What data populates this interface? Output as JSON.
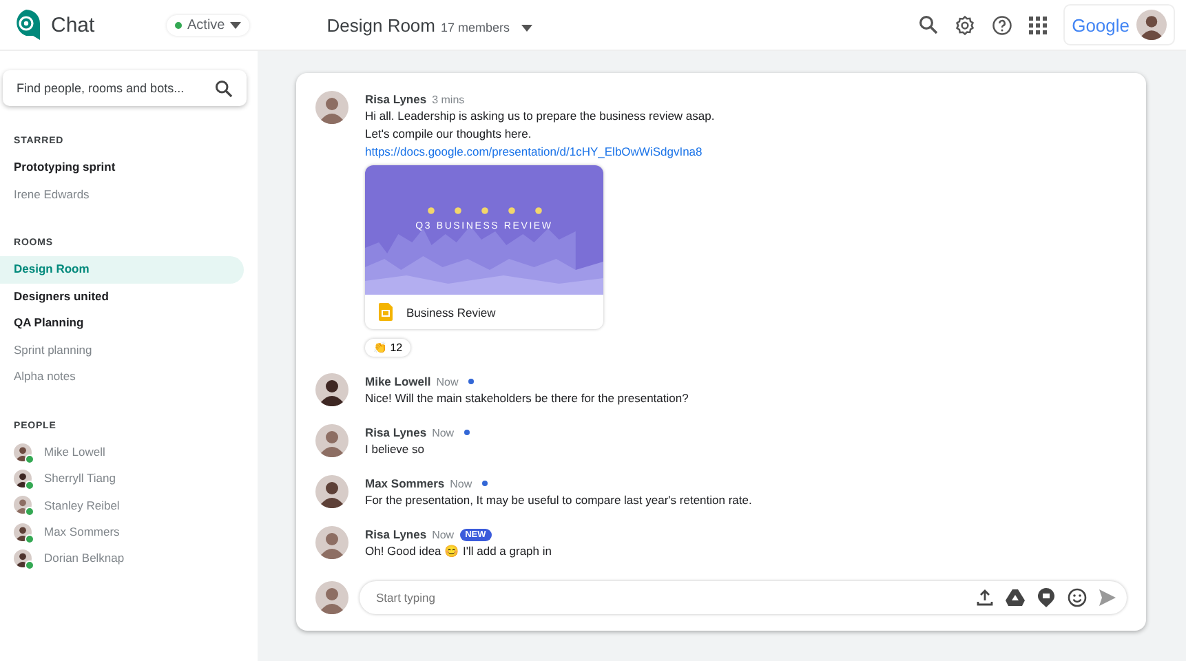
{
  "header": {
    "app_name": "Chat",
    "status": {
      "label": "Active",
      "online": true
    },
    "room": {
      "title": "Design Room",
      "members": "17 members"
    },
    "brand": "Google"
  },
  "search": {
    "placeholder": "Find people, rooms and bots..."
  },
  "sidebar": {
    "sections": [
      {
        "title": "STARRED",
        "kind": "rooms",
        "items": [
          {
            "label": "Prototyping sprint",
            "unread": true,
            "selected": false
          },
          {
            "label": "Irene Edwards",
            "unread": false,
            "selected": false
          }
        ]
      },
      {
        "title": "ROOMS",
        "kind": "rooms",
        "items": [
          {
            "label": "Design Room",
            "unread": true,
            "selected": true
          },
          {
            "label": "Designers united",
            "unread": true,
            "selected": false
          },
          {
            "label": "QA Planning",
            "unread": true,
            "selected": false
          },
          {
            "label": "Sprint planning",
            "unread": false,
            "selected": false
          },
          {
            "label": "Alpha notes",
            "unread": false,
            "selected": false
          }
        ]
      },
      {
        "title": "PEOPLE",
        "kind": "people",
        "items": [
          {
            "label": "Mike Lowell",
            "online": true
          },
          {
            "label": "Sherryll Tiang",
            "online": true
          },
          {
            "label": "Stanley Reibel",
            "online": true
          },
          {
            "label": "Max Sommers",
            "online": true
          },
          {
            "label": "Dorian Belknap",
            "online": true
          }
        ]
      }
    ]
  },
  "messages": [
    {
      "author": "Risa Lynes",
      "time": "3 mins",
      "unread_dot": false,
      "lines": [
        "Hi all. Leadership is asking us to prepare the business review asap.",
        "Let's compile our thoughts here."
      ],
      "link": "https://docs.google.com/presentation/d/1cHY_ElbOwWiSdgvIna8",
      "attachment": {
        "slide_title": "Q3 BUSINESS REVIEW",
        "name": "Business Review"
      },
      "reaction": {
        "emoji": "👏",
        "count": "12"
      }
    },
    {
      "author": "Mike Lowell",
      "time": "Now",
      "unread_dot": true,
      "lines": [
        "Nice! Will the main stakeholders be there for the presentation?"
      ]
    },
    {
      "author": "Risa Lynes",
      "time": "Now",
      "unread_dot": true,
      "lines": [
        "I believe so"
      ]
    },
    {
      "author": "Max Sommers",
      "time": "Now",
      "unread_dot": true,
      "lines": [
        "For the presentation, It may be useful to compare last year's retention rate."
      ]
    },
    {
      "author": "Risa Lynes",
      "time": "Now",
      "unread_dot": false,
      "badge": "NEW",
      "lines": [
        "Oh! Good idea 😊 I'll add a graph in"
      ]
    }
  ],
  "composer": {
    "placeholder": "Start typing"
  }
}
